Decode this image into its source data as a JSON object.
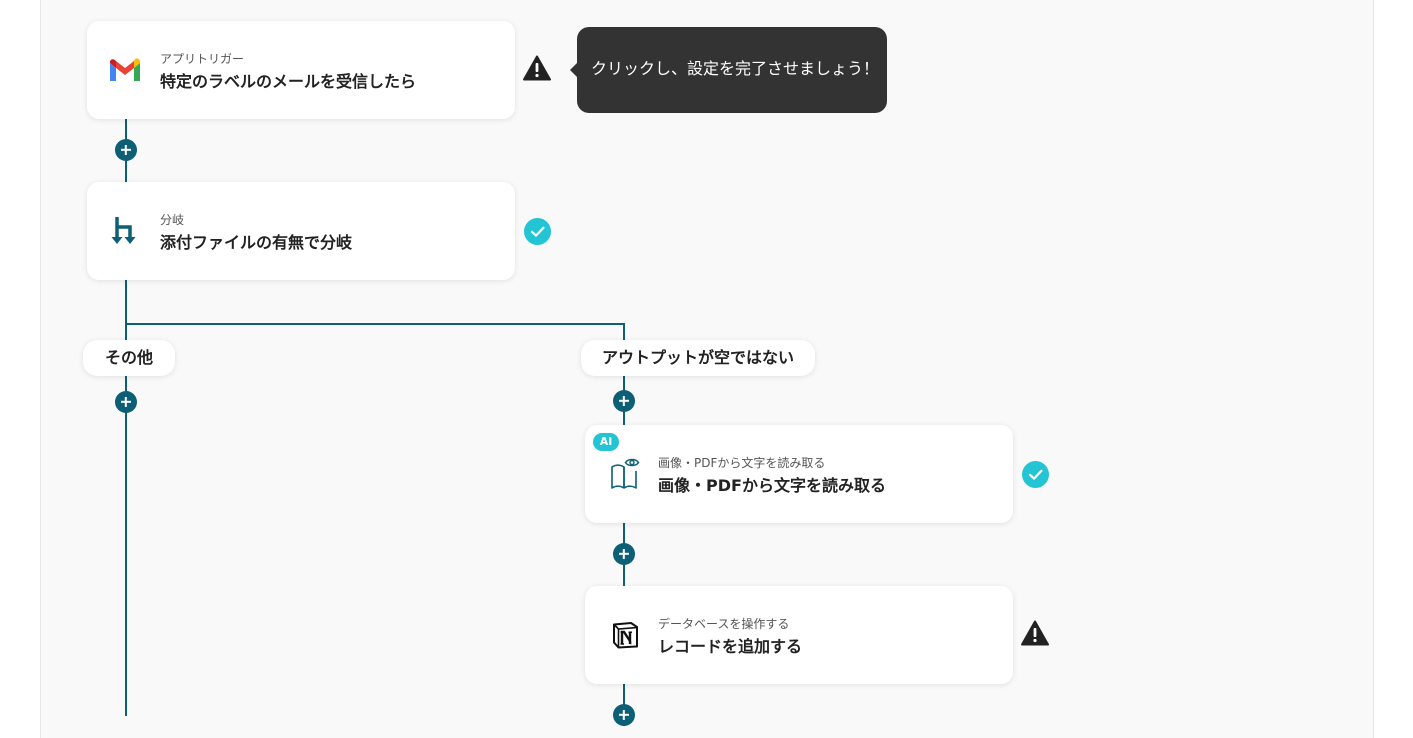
{
  "flow": {
    "trigger": {
      "sub_label": "アプリトリガー",
      "title": "特定のラベルのメールを受信したら",
      "icon": "gmail-icon",
      "status": "warning"
    },
    "tooltip": {
      "text": "クリックし、設定を完了させましょう！"
    },
    "branch": {
      "sub_label": "分岐",
      "title": "添付ファイルの有無で分岐",
      "icon": "branch-icon",
      "status": "complete"
    },
    "branches": {
      "left_label": "その他",
      "right_label": "アウトプットが空ではない"
    },
    "ocr_step": {
      "badge": "AI",
      "sub_label": "画像・PDFから文字を読み取る",
      "title": "画像・PDFから文字を読み取る",
      "icon": "book-eye-icon",
      "status": "complete"
    },
    "notion_step": {
      "sub_label": "データベースを操作する",
      "title": "レコードを追加する",
      "icon": "notion-icon",
      "status": "warning"
    }
  },
  "colors": {
    "connector": "#0d5f75",
    "complete": "#23c4d4",
    "warning": "#222222",
    "tooltip_bg": "#333333",
    "canvas_bg": "#f9f9f9"
  }
}
